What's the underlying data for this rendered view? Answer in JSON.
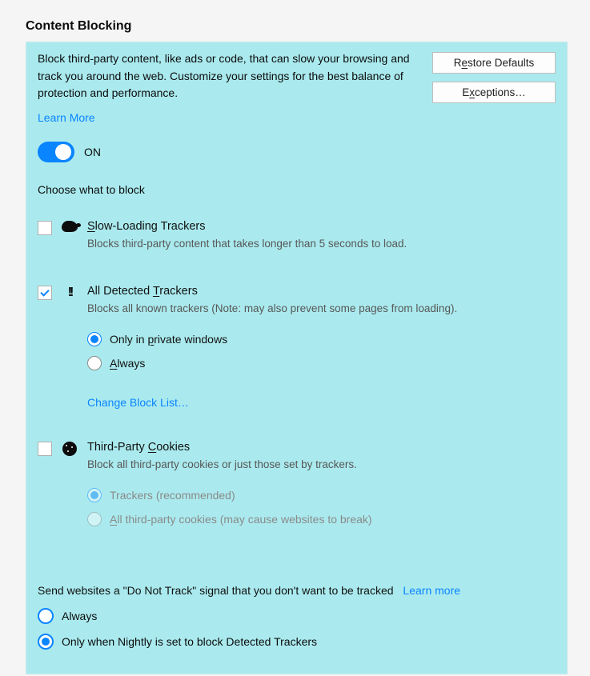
{
  "title": "Content Blocking",
  "description": "Block third-party content, like ads or code, that can slow your browsing and track you around the web. Customize your settings for the best balance of protection and performance.",
  "learn_more": "Learn More",
  "buttons": {
    "restore_pre": "R",
    "restore_key": "e",
    "restore_post": "store Defaults",
    "exceptions_pre": "E",
    "exceptions_key": "x",
    "exceptions_post": "ceptions…"
  },
  "toggle": {
    "state": "ON"
  },
  "choose_header": "Choose what to block",
  "items": {
    "slow": {
      "checked": false,
      "title_key": "S",
      "title_post": "low-Loading Trackers",
      "desc": "Blocks third-party content that takes longer than 5 seconds to load."
    },
    "detected": {
      "checked": true,
      "title_pre": "All Detected ",
      "title_key": "T",
      "title_post": "rackers",
      "desc": "Blocks all known trackers (Note: may also prevent some pages from loading).",
      "radio1_pre": "Only in ",
      "radio1_key": "p",
      "radio1_post": "rivate windows",
      "radio2_key": "A",
      "radio2_post": "lways",
      "change_link": "Change Block List…"
    },
    "cookies": {
      "checked": false,
      "title_pre": "Third-Party ",
      "title_key": "C",
      "title_post": "ookies",
      "desc": "Block all third-party cookies or just those set by trackers.",
      "radio1": "Trackers (recommended)",
      "radio2_key": "A",
      "radio2_post": "ll third-party cookies (may cause websites to break)"
    }
  },
  "dnt": {
    "text": "Send websites a \"Do Not Track\" signal that you don't want to be tracked",
    "learn": "Learn more",
    "opt_always": "Always",
    "opt_detected": "Only when Nightly is set to block Detected Trackers"
  }
}
